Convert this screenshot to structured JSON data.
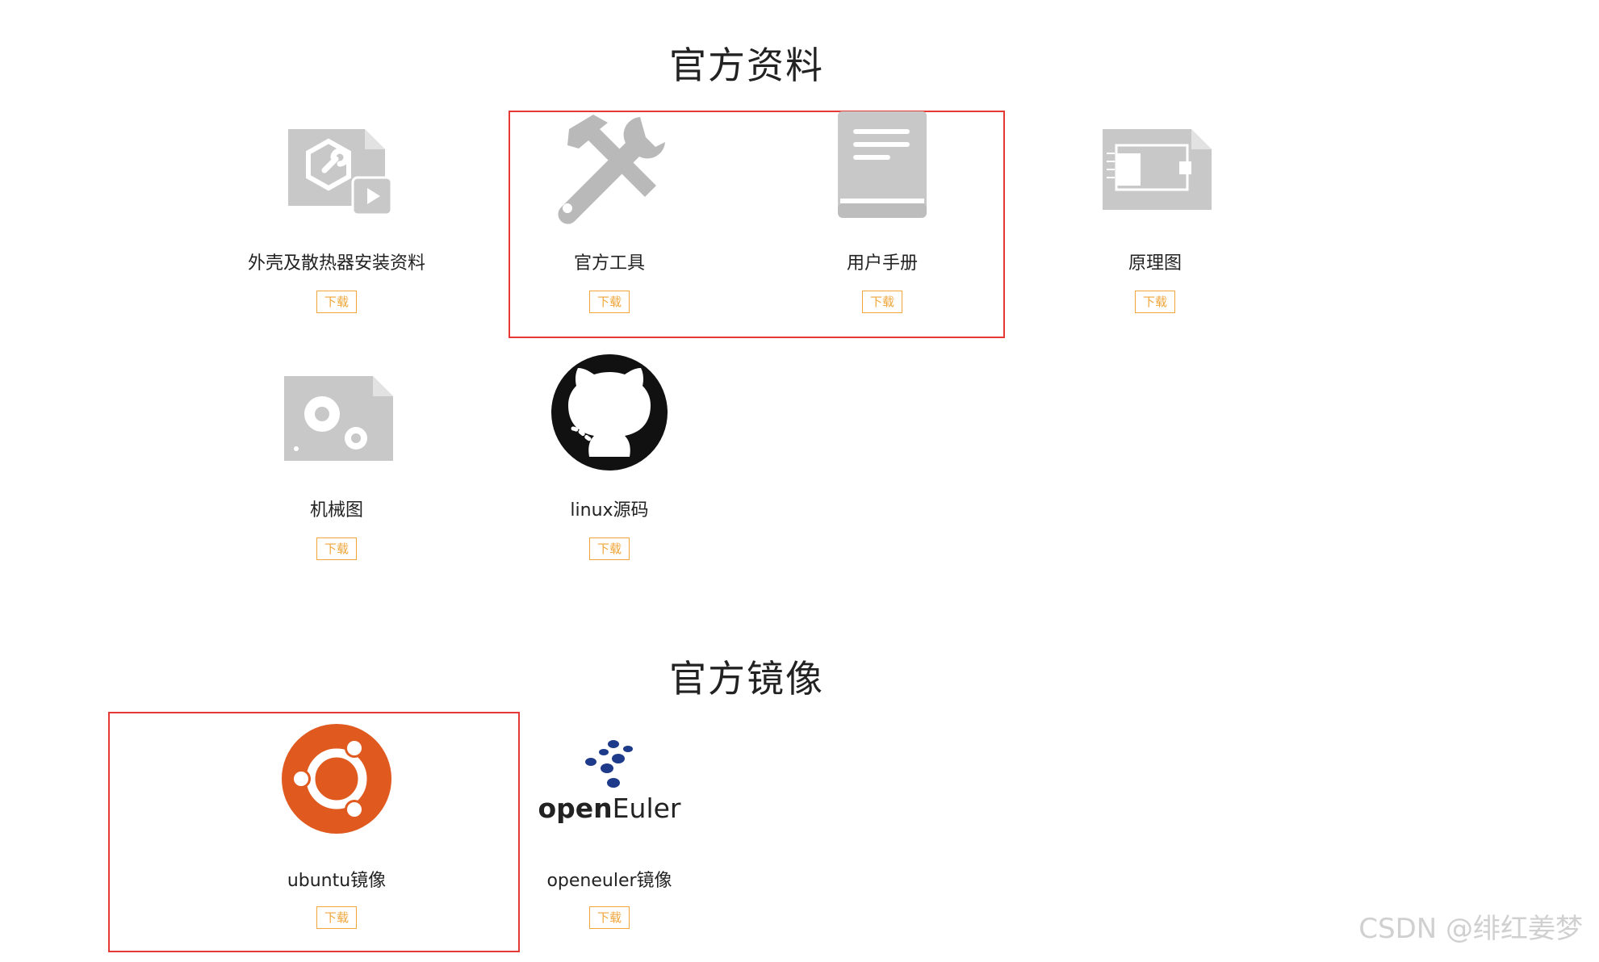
{
  "sections": {
    "docs_title": "官方资料",
    "mirrors_title": "官方镜像"
  },
  "items": {
    "shell": {
      "label": "外壳及散热器安装资料",
      "download": "下载"
    },
    "tools": {
      "label": "官方工具",
      "download": "下载"
    },
    "manual": {
      "label": "用户手册",
      "download": "下载"
    },
    "schematic": {
      "label": "原理图",
      "download": "下载"
    },
    "mechanical": {
      "label": "机械图",
      "download": "下载"
    },
    "linux": {
      "label": "linux源码",
      "download": "下载"
    },
    "ubuntu": {
      "label": "ubuntu镜像",
      "download": "下载"
    },
    "openeuler": {
      "label": "openeuler镜像",
      "download": "下载",
      "logo_text_open": "open",
      "logo_text_euler": "Euler"
    }
  },
  "colors": {
    "accent": "#f0a63a",
    "highlight": "#e53935",
    "icon_gray": "#c8c8c8",
    "ubuntu": "#e05a1f",
    "openeuler": "#1e3a8a"
  },
  "watermark": "CSDN @绯红姜梦"
}
